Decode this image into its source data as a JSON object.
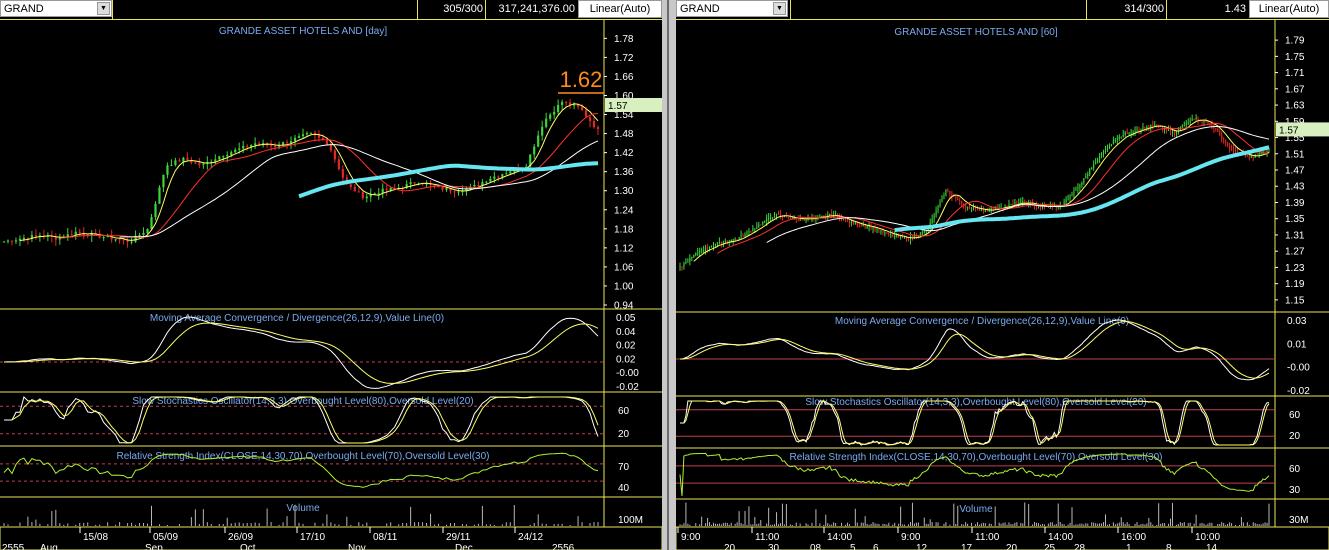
{
  "colors": {
    "up": "#3cd63c",
    "down": "#e02828",
    "ma_fast": "#ffff66",
    "ma_mid": "#ff3030",
    "ma_slow": "#ffffff",
    "ma_long": "#66e6f0",
    "border": "#e8e35a",
    "title": "#7aaaf0",
    "price_tag": "#d8f0c0",
    "peak": "#ff8a1a"
  },
  "left": {
    "symbol": "GRAND",
    "bars_info": "305/300",
    "volume_info": "317,241,376.00",
    "scale": "Linear(Auto)",
    "price_title": "GRANDE ASSET HOTELS AND [day]",
    "peak_label": "1.62",
    "last_price": "1.57",
    "price_ticks": [
      "1.78",
      "1.72",
      "1.66",
      "1.60",
      "1.54",
      "1.48",
      "1.42",
      "1.36",
      "1.30",
      "1.24",
      "1.18",
      "1.12",
      "1.06",
      "1.00",
      "0.94"
    ],
    "macd_title": "Moving Average Convergence / Divergence(26,12,9),Value Line(0)",
    "macd_ticks": [
      "0.05",
      "0.04",
      "0.02",
      "0.02",
      "-0.00",
      "-0.02"
    ],
    "stoch_title": "Slow Stochastics Oscillator(14,3,3),Overbought Level(80),Oversold Level(20)",
    "stoch_ticks": [
      "60",
      "20"
    ],
    "rsi_title": "Relative Strength Index(CLOSE,14,30,70),Overbought Level(70),Oversold Level(30)",
    "rsi_ticks": [
      "70",
      "40"
    ],
    "vol_title": "Volume",
    "vol_ticks": [
      "100M"
    ],
    "date_ticks": [
      "15/08",
      "05/09",
      "26/09",
      "17/10",
      "08/11",
      "29/11",
      "24/12"
    ],
    "month_ticks": [
      "2555",
      "Aug",
      "Sep",
      "Oct",
      "Nov",
      "Dec",
      "2556"
    ]
  },
  "right": {
    "symbol": "GRAND",
    "bars_info": "314/300",
    "volume_info": "1.43",
    "scale": "Linear(Auto)",
    "price_title": "GRANDE ASSET HOTELS AND [60]",
    "last_price": "1.57",
    "price_ticks": [
      "1.79",
      "1.75",
      "1.71",
      "1.67",
      "1.63",
      "1.59",
      "1.55",
      "1.51",
      "1.47",
      "1.43",
      "1.39",
      "1.35",
      "1.31",
      "1.27",
      "1.23",
      "1.19",
      "1.15"
    ],
    "macd_title": "Moving Average Convergence / Divergence(26,12,9),Value Line(0)",
    "macd_ticks": [
      "0.03",
      "0.01",
      "-0.00",
      "-0.02"
    ],
    "stoch_title": "Slow Stochastics Oscillator(14,3,3),Overbought Level(80),Oversold Level(20)",
    "stoch_ticks": [
      "60",
      "20"
    ],
    "rsi_title": "Relative Strength Index(CLOSE,14,30,70),Overbought Level(70),Oversold Level(30)",
    "rsi_ticks": [
      "60",
      "30"
    ],
    "vol_title": "Volume",
    "vol_ticks": [
      "30M"
    ],
    "date_ticks": [
      "9:00",
      "11:00",
      "14:00",
      "9:00",
      "11:00",
      "14:00",
      "16:00",
      "10:00"
    ],
    "day_ticks": [
      "20",
      "30",
      "08",
      "5",
      "6",
      "12",
      "17",
      "20",
      "25",
      "28",
      "1",
      "8",
      "14"
    ]
  },
  "chart_data": [
    {
      "type": "line",
      "title": "GRANDE ASSET HOTELS AND [day]",
      "ylim": [
        0.94,
        1.8
      ],
      "x": [
        "15/08",
        "05/09",
        "26/09",
        "17/10",
        "08/11",
        "29/11",
        "24/12"
      ],
      "series": [
        {
          "values": [
            1.14,
            1.15,
            1.16,
            1.15,
            1.17,
            1.16,
            1.15,
            1.14,
            1.18,
            1.38,
            1.4,
            1.38,
            1.41,
            1.43,
            1.45,
            1.44,
            1.46,
            1.48,
            1.45,
            1.32,
            1.28,
            1.3,
            1.31,
            1.33,
            1.31,
            1.3,
            1.31,
            1.34,
            1.36,
            1.38,
            1.52,
            1.58,
            1.56,
            1.49
          ]
        }
      ]
    },
    {
      "type": "line",
      "title": "GRANDE ASSET HOTELS AND [60]",
      "ylim": [
        1.13,
        1.81
      ],
      "x": [
        "9:00",
        "11:00",
        "14:00",
        "9:00",
        "11:00",
        "14:00",
        "16:00",
        "10:00"
      ],
      "series": [
        {
          "values": [
            1.23,
            1.27,
            1.29,
            1.3,
            1.33,
            1.36,
            1.35,
            1.35,
            1.36,
            1.34,
            1.33,
            1.31,
            1.3,
            1.32,
            1.42,
            1.38,
            1.37,
            1.38,
            1.39,
            1.38,
            1.38,
            1.43,
            1.5,
            1.55,
            1.57,
            1.58,
            1.56,
            1.6,
            1.58,
            1.52,
            1.5,
            1.52
          ]
        }
      ]
    }
  ]
}
